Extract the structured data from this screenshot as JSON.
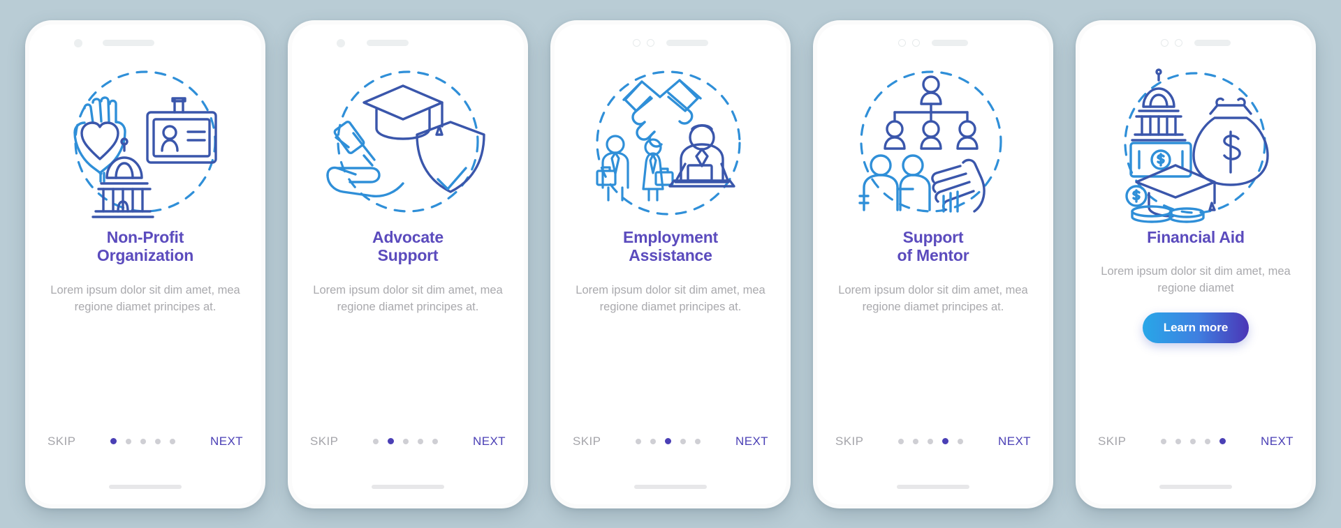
{
  "background_color": "#b9ccd5",
  "theme": {
    "title_color": "#4a3fb5",
    "body_color": "#a9a9ad",
    "accent_color": "#4a3fb5",
    "icon_blue": "#2f8fd8",
    "icon_indigo": "#3a56ab",
    "button_gradient_from": "#28a7e8",
    "button_gradient_to": "#4b35b6"
  },
  "common": {
    "skip_label": "SKIP",
    "next_label": "NEXT",
    "total_steps": 5
  },
  "screens": [
    {
      "id": "non-profit-organization",
      "title_lines": [
        "Non-Profit",
        "Organization"
      ],
      "body": "Lorem ipsum dolor sit dim amet, mea regione diamet principes at.",
      "active_step": 1,
      "notch": "dot-and-speaker",
      "icon": "hands-heart-id-card-capitol",
      "has_learn_more": false
    },
    {
      "id": "advocate-support",
      "title_lines": [
        "Advocate",
        "Support"
      ],
      "body": "Lorem ipsum dolor sit dim amet, mea regione diamet principes at.",
      "active_step": 2,
      "notch": "dot-and-speaker",
      "icon": "graduation-cap-gavel-shield",
      "has_learn_more": false
    },
    {
      "id": "employment-assistance",
      "title_lines": [
        "Employment",
        "Assistance"
      ],
      "body": "Lorem ipsum dolor sit dim amet, mea regione diamet principes at.",
      "active_step": 3,
      "notch": "two-rings-and-speaker",
      "icon": "handshake-workers-laptop",
      "has_learn_more": false
    },
    {
      "id": "support-of-mentor",
      "title_lines": [
        "Support",
        "of Mentor"
      ],
      "body": "Lorem ipsum dolor sit dim amet, mea regione diamet principes at.",
      "active_step": 4,
      "notch": "two-rings-and-speaker",
      "icon": "org-chart-people-hand",
      "has_learn_more": false
    },
    {
      "id": "financial-aid",
      "title_lines": [
        "Financial Aid"
      ],
      "body": "Lorem ipsum dolor sit dim amet, mea regione diamet",
      "active_step": 5,
      "notch": "two-rings-and-speaker",
      "icon": "capitol-money-bag-graduation-coins",
      "has_learn_more": true,
      "learn_more_label": "Learn more"
    }
  ]
}
